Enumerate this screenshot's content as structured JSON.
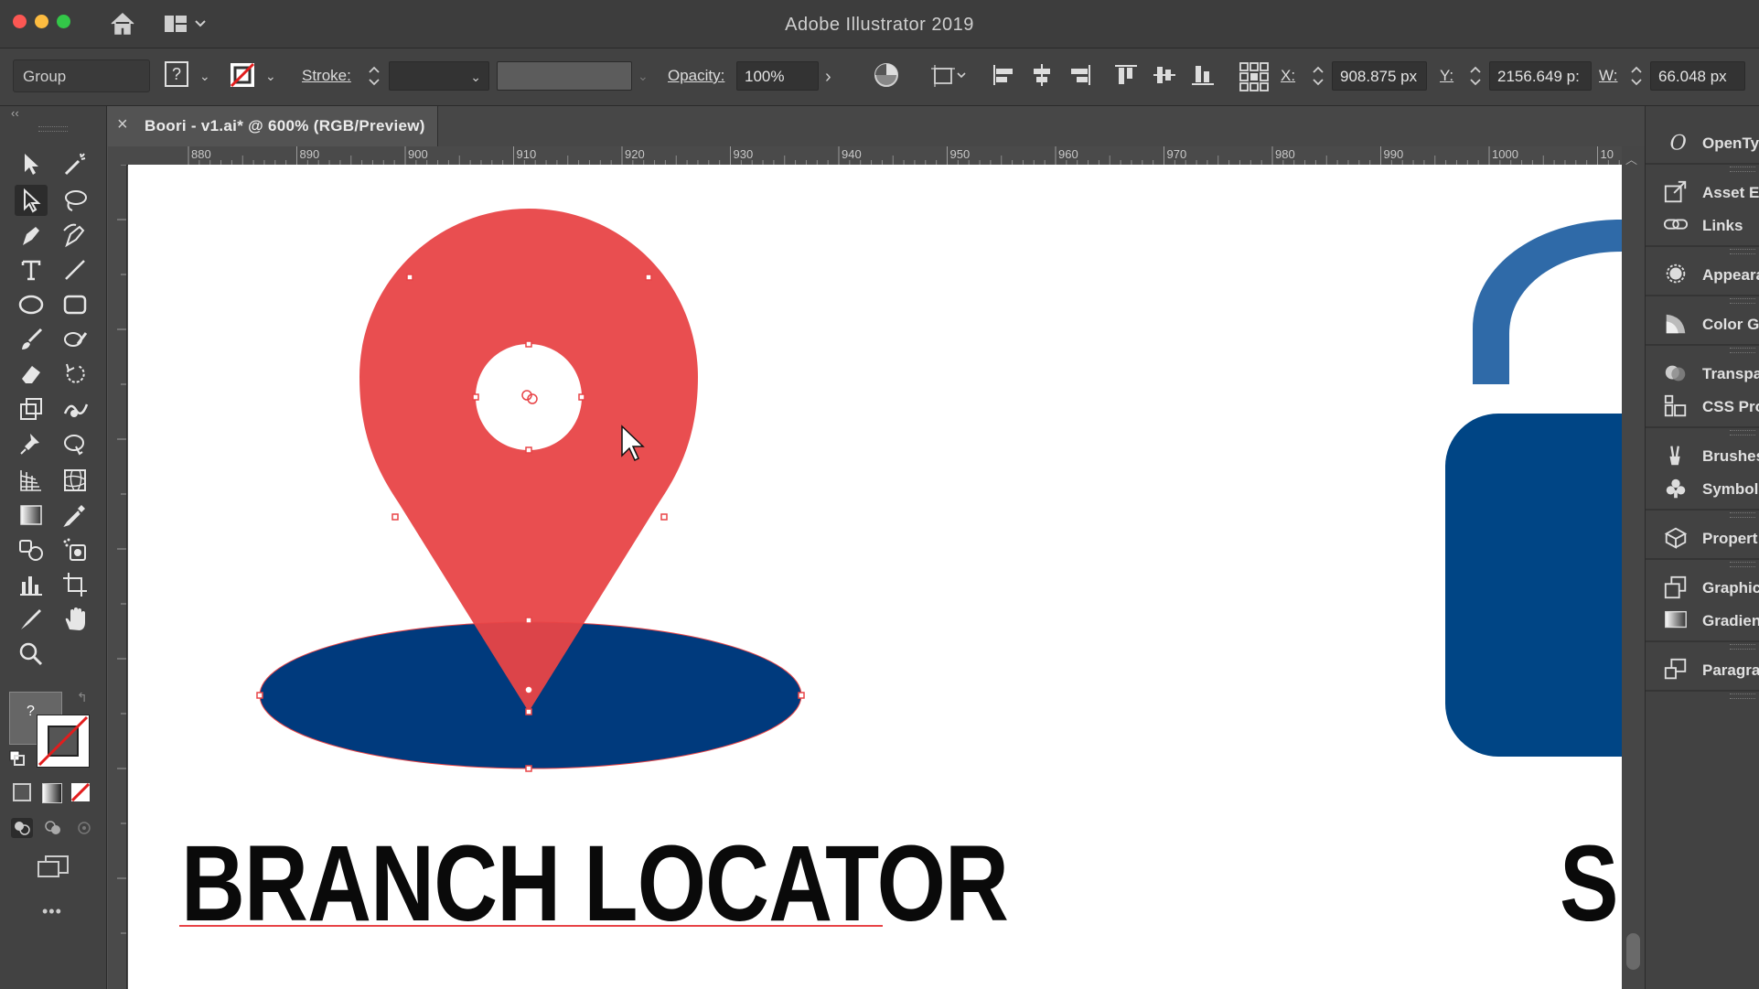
{
  "app": {
    "title": "Adobe Illustrator 2019"
  },
  "controlbar": {
    "selection_type": "Group",
    "stroke_label": "Stroke:",
    "opacity_label": "Opacity:",
    "opacity_value": "100%",
    "x_label": "X:",
    "x_value": "908.875 px",
    "y_label": "Y:",
    "y_value": "2156.649 p:",
    "w_label": "W:",
    "w_value": "66.048 px",
    "fill_indicator": "?"
  },
  "document": {
    "tab_title": "Boori - v1.ai* @ 600% (RGB/Preview)",
    "close_glyph": "×"
  },
  "ruler": {
    "labels": [
      "880",
      "890",
      "900",
      "910",
      "920",
      "930",
      "940",
      "950",
      "960",
      "970",
      "980",
      "990",
      "1000",
      "10"
    ]
  },
  "canvas": {
    "headline": "BRANCH LOCATOR",
    "headline_2": "SI",
    "colors": {
      "pin": "#e84447",
      "ellipse": "#003a7d",
      "lock": "#2f6aa8",
      "lock_body": "#004585",
      "text": "#0a0a0a"
    }
  },
  "dock": {
    "items": [
      {
        "label": "OpenTy",
        "icon": "opentype-icon"
      },
      {
        "label": "Asset E",
        "icon": "asset-export-icon"
      },
      {
        "label": "Links",
        "icon": "links-icon"
      },
      {
        "label": "Appeara",
        "icon": "appearance-icon"
      },
      {
        "label": "Color G",
        "icon": "color-guide-icon"
      },
      {
        "label": "Transpa",
        "icon": "transparency-icon"
      },
      {
        "label": "CSS Pro",
        "icon": "css-properties-icon"
      },
      {
        "label": "Brushes",
        "icon": "brushes-icon"
      },
      {
        "label": "Symbol",
        "icon": "symbols-icon"
      },
      {
        "label": "Propert",
        "icon": "properties-icon"
      },
      {
        "label": "Graphic",
        "icon": "graphic-styles-icon"
      },
      {
        "label": "Gradien",
        "icon": "gradient-icon"
      },
      {
        "label": "Paragra",
        "icon": "paragraph-icon"
      }
    ]
  },
  "toolbar": {
    "more_glyph": "•••",
    "collapse_glyph": "‹‹"
  }
}
